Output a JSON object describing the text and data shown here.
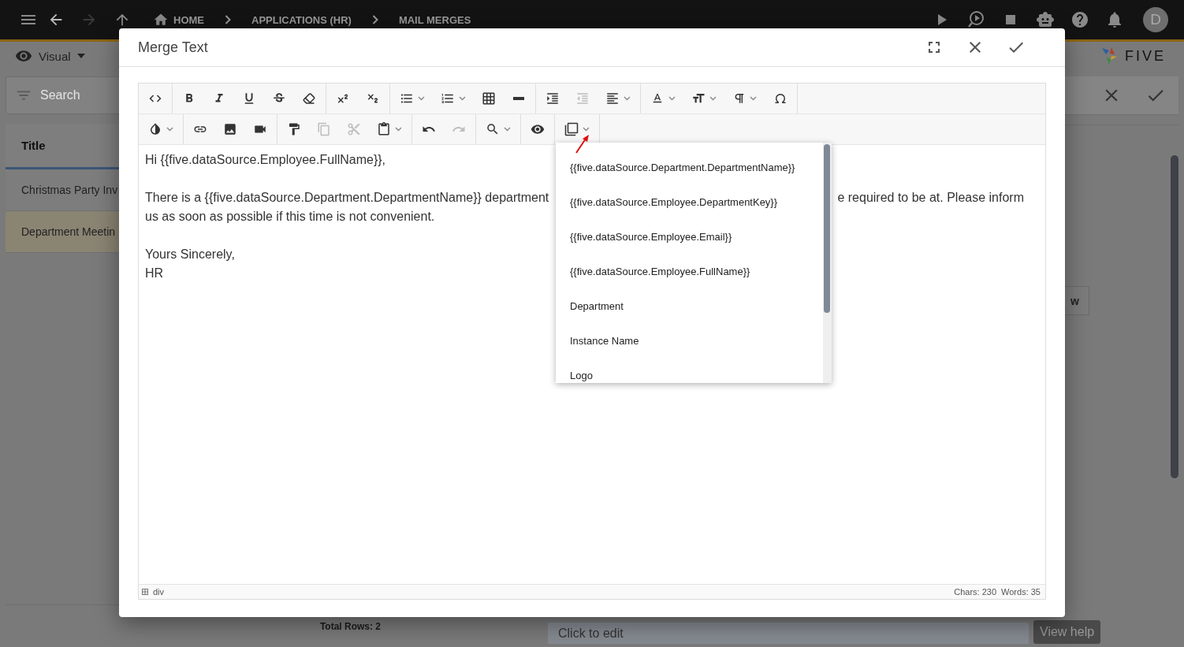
{
  "top_bar": {
    "breadcrumbs": [
      "HOME",
      "APPLICATIONS (HR)",
      "MAIL MERGES"
    ],
    "avatar": "D"
  },
  "view_mode": {
    "label": "Visual"
  },
  "search": {
    "placeholder": "Search"
  },
  "list": {
    "column": "Title",
    "rows": [
      {
        "title": "Christmas Party Inv",
        "selected": false
      },
      {
        "title": "Department Meetin",
        "selected": true
      }
    ],
    "total": "Total Rows: 2"
  },
  "logo": {
    "text": "FIVE"
  },
  "detail": {
    "button": "w",
    "field": {
      "placeholder": "Click to edit"
    },
    "help": "View help"
  },
  "dialog": {
    "title": "Merge Text",
    "toolbar": [
      [
        [
          {
            "kind": "code",
            "disabled": false,
            "dropdown": false
          }
        ],
        [
          {
            "kind": "bold",
            "disabled": false,
            "dropdown": false
          },
          {
            "kind": "italic",
            "disabled": false,
            "dropdown": false
          },
          {
            "kind": "underline",
            "disabled": false,
            "dropdown": false
          },
          {
            "kind": "strike",
            "disabled": false,
            "dropdown": false
          },
          {
            "kind": "eraser",
            "disabled": false,
            "dropdown": false
          }
        ],
        [
          {
            "kind": "superscript",
            "disabled": false,
            "dropdown": false
          },
          {
            "kind": "subscript",
            "disabled": false,
            "dropdown": false
          }
        ],
        [
          {
            "kind": "bullets",
            "disabled": false,
            "dropdown": true
          },
          {
            "kind": "numbers",
            "disabled": false,
            "dropdown": true
          },
          {
            "kind": "table",
            "disabled": false,
            "dropdown": false
          },
          {
            "kind": "rule",
            "disabled": false,
            "dropdown": false
          }
        ],
        [
          {
            "kind": "indent",
            "disabled": false,
            "dropdown": false
          },
          {
            "kind": "outdent",
            "disabled": true,
            "dropdown": false
          },
          {
            "kind": "align",
            "disabled": false,
            "dropdown": true
          }
        ],
        [
          {
            "kind": "font",
            "disabled": false,
            "dropdown": true
          },
          {
            "kind": "size",
            "disabled": false,
            "dropdown": true
          },
          {
            "kind": "paragraph",
            "disabled": false,
            "dropdown": true
          },
          {
            "kind": "special",
            "disabled": false,
            "dropdown": false
          }
        ]
      ],
      [
        [
          {
            "kind": "color",
            "disabled": false,
            "dropdown": true
          }
        ],
        [
          {
            "kind": "link",
            "disabled": false,
            "dropdown": false
          },
          {
            "kind": "image",
            "disabled": false,
            "dropdown": false
          },
          {
            "kind": "video",
            "disabled": false,
            "dropdown": false
          }
        ],
        [
          {
            "kind": "painter",
            "disabled": false,
            "dropdown": false
          },
          {
            "kind": "copy",
            "disabled": true,
            "dropdown": false
          },
          {
            "kind": "cut",
            "disabled": true,
            "dropdown": false
          },
          {
            "kind": "paste",
            "disabled": false,
            "dropdown": true
          }
        ],
        [
          {
            "kind": "undo",
            "disabled": false,
            "dropdown": false
          },
          {
            "kind": "redo",
            "disabled": true,
            "dropdown": false
          }
        ],
        [
          {
            "kind": "find",
            "disabled": false,
            "dropdown": true
          }
        ],
        [
          {
            "kind": "preview",
            "disabled": false,
            "dropdown": false
          }
        ],
        [
          {
            "kind": "merge",
            "disabled": false,
            "dropdown": true
          }
        ]
      ]
    ],
    "editor": {
      "paragraphs": [
        [
          [
            "Hi {{five.dataSource.Employee.FullName}},"
          ]
        ],
        [
          [
            "There is a {{five.dataSource.Department.DepartmentName}} department",
            "e required to be at. Please inform"
          ],
          [
            "us as soon as possible if this time is not convenient."
          ]
        ],
        [
          [
            "Yours Sincerely,"
          ],
          [
            "HR"
          ]
        ]
      ]
    },
    "status": {
      "path": "div",
      "chars": "Chars: 230",
      "words": "Words: 35"
    },
    "merge_menu": {
      "items": [
        "{{five.dataSource.Department.DepartmentName}}",
        "{{five.dataSource.Employee.DepartmentKey}}",
        "{{five.dataSource.Employee.Email}}",
        "{{five.dataSource.Employee.FullName}}",
        "Department",
        "Instance Name",
        "Logo"
      ]
    }
  }
}
